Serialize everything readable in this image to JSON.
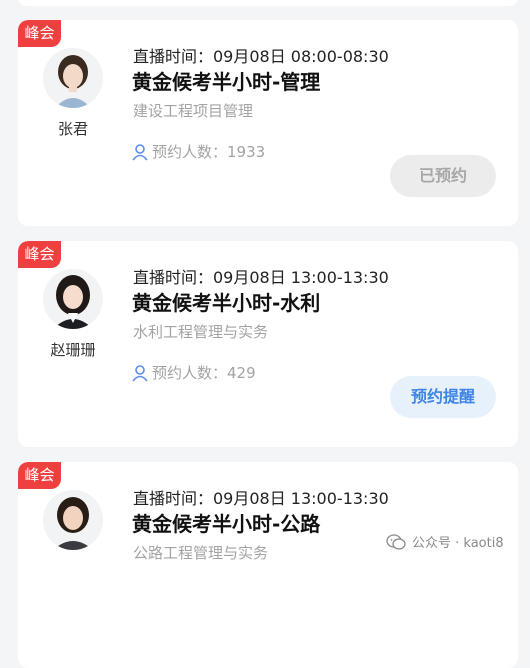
{
  "sessions": [
    {
      "badge": "峰会",
      "teacher": "张君",
      "time": "直播时间：09月08日 08:00-08:30",
      "title": "黄金候考半小时-管理",
      "subject": "建设工程项目管理",
      "count": "预约人数：1933",
      "button": "已预约",
      "button_state": "booked"
    },
    {
      "badge": "峰会",
      "teacher": "赵珊珊",
      "time": "直播时间：09月08日 13:00-13:30",
      "title": "黄金候考半小时-水利",
      "subject": "水利工程管理与实务",
      "count": "预约人数：429",
      "button": "预约提醒",
      "button_state": "remind"
    },
    {
      "badge": "峰会",
      "time": "直播时间：09月08日 13:00-13:30",
      "title": "黄金候考半小时-公路",
      "subject": "公路工程管理与实务"
    }
  ],
  "watermark": "公众号 · kaoti8",
  "colors": {
    "badge": "#ef4040",
    "booked_bg": "#ececec",
    "remind_bg": "#e7f1fc",
    "remind_text": "#3f84e6",
    "user_icon": "#5b8fe8"
  }
}
